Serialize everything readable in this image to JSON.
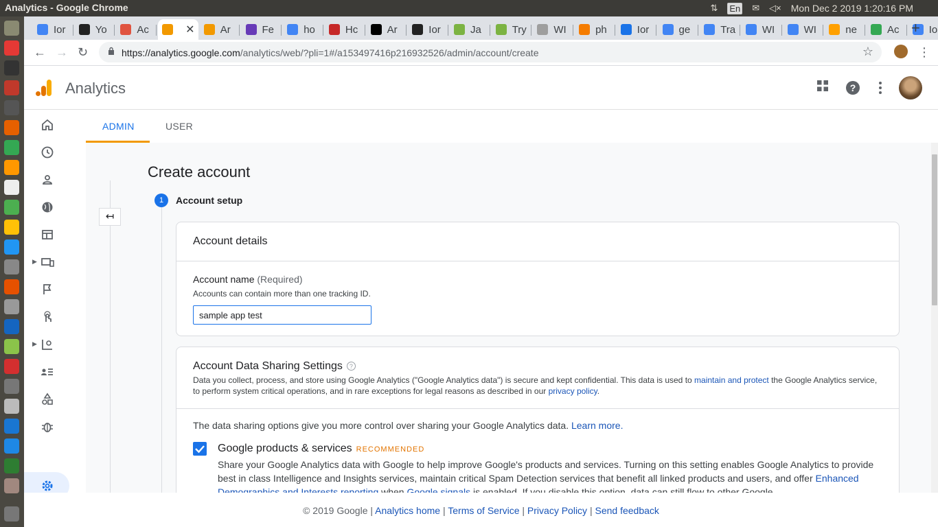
{
  "os": {
    "window_title": "Analytics - Google Chrome",
    "lang": "En",
    "clock": "Mon Dec  2 2019  1:20:16 PM"
  },
  "browser": {
    "tabs": [
      {
        "label": "Ior",
        "color": "#4285f4"
      },
      {
        "label": "Yo",
        "color": "#222222"
      },
      {
        "label": "Ac",
        "color": "#e0533f"
      },
      {
        "label": "",
        "color": "#f29900",
        "active": true
      },
      {
        "label": "Ar",
        "color": "#f29900"
      },
      {
        "label": "Fe",
        "color": "#673ab7"
      },
      {
        "label": "ho",
        "color": "#4285f4"
      },
      {
        "label": "Hc",
        "color": "#c62828"
      },
      {
        "label": "Ar",
        "color": "#000000"
      },
      {
        "label": "Ior",
        "color": "#222222"
      },
      {
        "label": "Ja",
        "color": "#7cb342"
      },
      {
        "label": "Try",
        "color": "#7cb342"
      },
      {
        "label": "WI",
        "color": "#9e9e9e"
      },
      {
        "label": "ph",
        "color": "#f57c00"
      },
      {
        "label": "Ior",
        "color": "#1a73e8"
      },
      {
        "label": "ge",
        "color": "#4285f4"
      },
      {
        "label": "Tra",
        "color": "#4285f4"
      },
      {
        "label": "WI",
        "color": "#4285f4"
      },
      {
        "label": "WI",
        "color": "#4285f4"
      },
      {
        "label": "ne",
        "color": "#ffa000"
      },
      {
        "label": "Ac",
        "color": "#34a853"
      },
      {
        "label": "Ior",
        "color": "#4285f4"
      }
    ],
    "url_domain": "https://analytics.google.com",
    "url_path": "/analytics/web/?pli=1#/a153497416p216932526/admin/account/create"
  },
  "app": {
    "title": "Analytics"
  },
  "admin_tabs": {
    "admin": "ADMIN",
    "user": "USER"
  },
  "page": {
    "title": "Create account",
    "step_number": "1",
    "step_label": "Account setup"
  },
  "account_details": {
    "heading": "Account details",
    "name_label": "Account name",
    "name_required": "(Required)",
    "name_hint": "Accounts can contain more than one tracking ID.",
    "name_value": "sample app test"
  },
  "sharing": {
    "heading": "Account Data Sharing Settings",
    "desc_pre": "Data you collect, process, and store using Google Analytics (\"Google Analytics data\") is secure and kept confidential. This data is used to ",
    "desc_link1": "maintain and protect",
    "desc_mid": " the Google Analytics service, to perform system critical operations, and in rare exceptions for legal reasons as described in our ",
    "desc_link2": "privacy policy",
    "desc_post": ".",
    "intro": "The data sharing options give you more control over sharing your Google Analytics data. ",
    "intro_link": "Learn more.",
    "gps_title": "Google products & services",
    "gps_badge": "RECOMMENDED",
    "gps_checked": true,
    "gps_desc_pre": "Share your Google Analytics data with Google to help improve Google's products and services. Turning on this setting enables Google Analytics to provide best in class Intelligence and Insights services, maintain critical Spam Detection services that benefit all linked products and users, and offer ",
    "gps_link1": "Enhanced Demographics and Interests reporting",
    "gps_desc_mid": " when ",
    "gps_link2": "Google signals",
    "gps_desc_post": " is enabled. If you disable this option, data can still flow to other Google"
  },
  "footer": {
    "copyright": "© 2019 Google",
    "sep": " | ",
    "home": "Analytics home",
    "terms": "Terms of Service",
    "privacy": "Privacy Policy",
    "feedback": "Send feedback"
  }
}
